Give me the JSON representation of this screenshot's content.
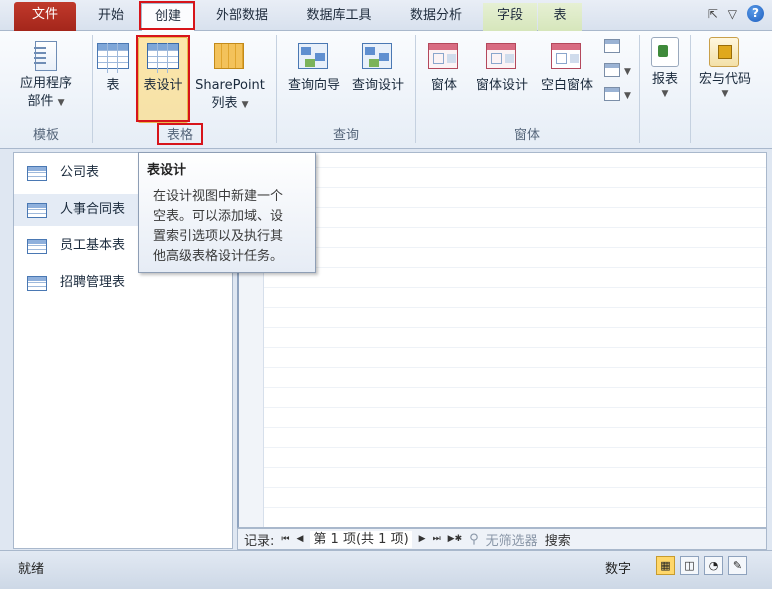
{
  "tabs": [
    {
      "label": "文件",
      "id": "file"
    },
    {
      "label": "开始",
      "id": "home"
    },
    {
      "label": "创建",
      "id": "create"
    },
    {
      "label": "外部数据",
      "id": "external"
    },
    {
      "label": "数据库工具",
      "id": "dbtools"
    },
    {
      "label": "数据分析",
      "id": "analysis"
    },
    {
      "label": "字段",
      "id": "fields"
    },
    {
      "label": "表",
      "id": "table"
    }
  ],
  "ribbon": {
    "templates": {
      "app_parts_line1": "应用程序",
      "app_parts_line2": "部件",
      "group_label": "模板"
    },
    "tables": {
      "table": "表",
      "table_design": "表设计",
      "sharepoint_line1": "SharePoint",
      "sharepoint_line2": "列表",
      "group_label": "表格"
    },
    "queries": {
      "query_wizard": "查询向导",
      "query_design": "查询设计",
      "group_label": "查询"
    },
    "forms": {
      "form": "窗体",
      "form_design": "窗体设计",
      "blank_form": "空白窗体",
      "group_label": "窗体"
    },
    "reports": {
      "label": "报表"
    },
    "macros": {
      "label": "宏与代码"
    }
  },
  "nav": {
    "items": [
      {
        "label": "公司表"
      },
      {
        "label": "人事合同表"
      },
      {
        "label": "员工基本表"
      },
      {
        "label": "招聘管理表"
      }
    ]
  },
  "tooltip": {
    "title": "表设计",
    "lines": [
      "在设计视图中新建一个",
      "空表。可以添加域、设",
      "置索引选项以及执行其",
      "他高级表格设计任务。"
    ]
  },
  "record_bar": {
    "label": "记录:",
    "position": "第 1 项(共 1 项)",
    "filter": "无筛选器",
    "search": "搜索"
  },
  "status": {
    "left": "就绪",
    "right": "数字"
  },
  "colors": {
    "file_tab": "#b2301f",
    "highlight_box": "#d7141a",
    "selected_button": "#ffd66b"
  }
}
